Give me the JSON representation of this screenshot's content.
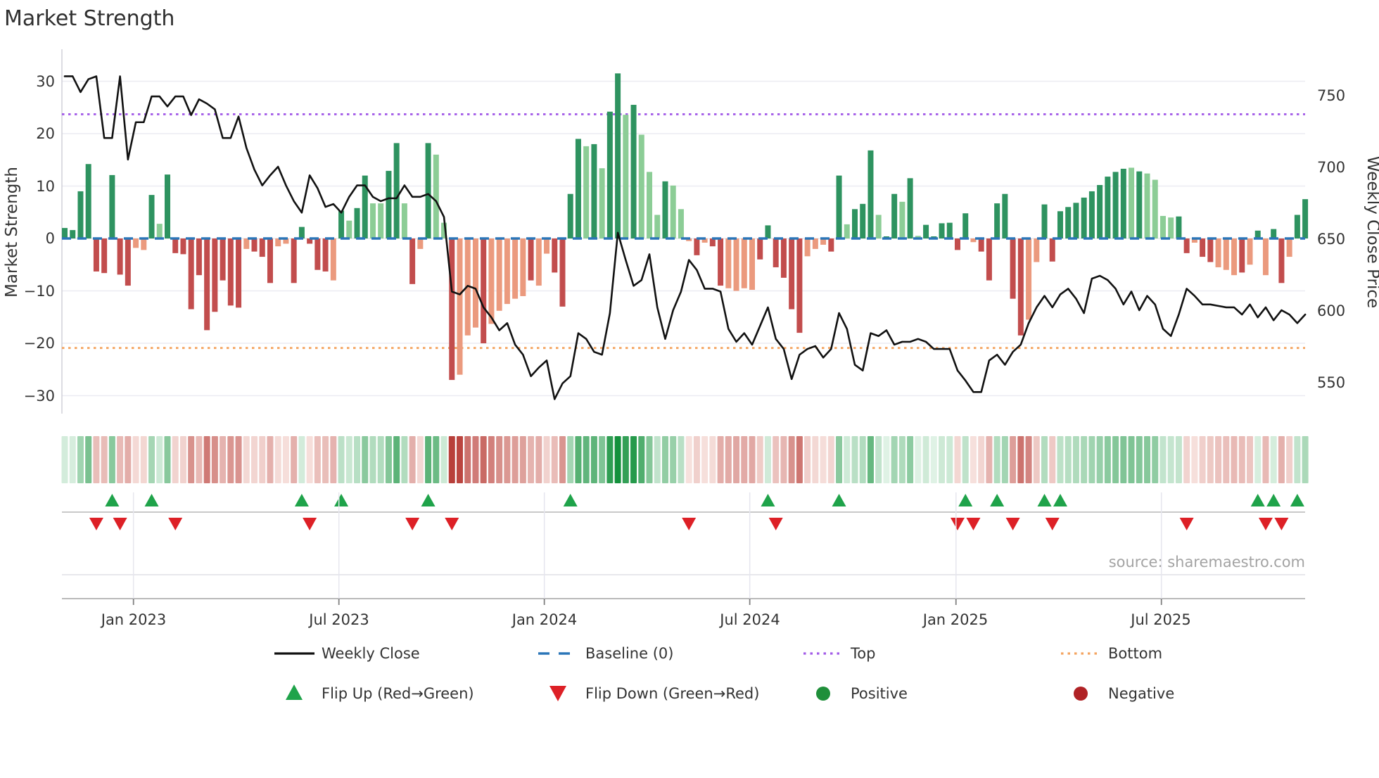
{
  "title": "Market Strength",
  "source_note": "source: sharemaestro.com",
  "axes": {
    "left": {
      "title": "Market Strength",
      "tick_labels": [
        "30",
        "20",
        "10",
        "0",
        "−10",
        "−20",
        "−30"
      ]
    },
    "right": {
      "title": "Weekly Close Price",
      "tick_labels": [
        "750",
        "700",
        "650",
        "600",
        "550"
      ]
    },
    "x": {
      "tick_labels": [
        "Jan 2023",
        "Jul 2023",
        "Jan 2024",
        "Jul 2024",
        "Jan 2025",
        "Jul 2025"
      ]
    }
  },
  "legend": {
    "weekly_close": "Weekly Close",
    "baseline": "Baseline (0)",
    "top": "Top",
    "bottom": "Bottom",
    "flip_up": "Flip Up (Red→Green)",
    "flip_down": "Flip Down (Green→Red)",
    "positive": "Positive",
    "negative": "Negative"
  },
  "colors": {
    "bar_green_dark": "#2e9360",
    "bar_green_light": "#8ccd96",
    "bar_red_dark": "#c24d4d",
    "bar_red_light": "#eb9a7e",
    "price_line": "#111111",
    "baseline": "#2b76b8",
    "top_line": "#a35ce8",
    "bottom_line": "#f4a460",
    "flip_up": "#1fa34a",
    "flip_down": "#dd2026",
    "positive_dot": "#1f8f3a",
    "negative_dot": "#b02225",
    "grid": "#ebebf2",
    "axis_text": "#333333",
    "source_text": "#a3a3a3",
    "heat_green_max": "#14913c",
    "heat_red_max": "#b63934"
  },
  "chart_data": {
    "type": "combo: weekly strength bars + weekly close line + heatmap strip + flip markers",
    "title": "Market Strength",
    "x_tick_labels": [
      "Jan 2023",
      "Jul 2023",
      "Jan 2024",
      "Jul 2024",
      "Jan 2025",
      "Jul 2025"
    ],
    "x_tick_weeks": [
      8.7,
      34.7,
      60.7,
      86.7,
      112.8,
      138.8
    ],
    "weeks_total": 158,
    "left_axis": {
      "label": "Market Strength",
      "ticks": [
        30,
        20,
        10,
        0,
        -10,
        -20,
        -30
      ],
      "range": [
        -33,
        33
      ]
    },
    "right_axis": {
      "label": "Weekly Close Price",
      "ticks": [
        750,
        700,
        650,
        600,
        550
      ],
      "range": [
        528,
        772
      ]
    },
    "baseline_level": 0,
    "top_level": 23.7,
    "bottom_level": -20.9,
    "bar_shades": {
      "d": "dark = momentum strengthening",
      "l": "light = momentum fading"
    },
    "strength": [
      [
        2,
        "d"
      ],
      [
        1.6,
        "d"
      ],
      [
        9,
        "d"
      ],
      [
        14.2,
        "d"
      ],
      [
        -6.3,
        "d"
      ],
      [
        -6.6,
        "d"
      ],
      [
        12.1,
        "d"
      ],
      [
        -6.9,
        "d"
      ],
      [
        -9,
        "d"
      ],
      [
        -1.8,
        "l"
      ],
      [
        -2.2,
        "l"
      ],
      [
        8.3,
        "d"
      ],
      [
        2.8,
        "l"
      ],
      [
        12.2,
        "d"
      ],
      [
        -2.8,
        "d"
      ],
      [
        -3,
        "d"
      ],
      [
        -13.5,
        "d"
      ],
      [
        -7,
        "d"
      ],
      [
        -17.5,
        "d"
      ],
      [
        -14,
        "d"
      ],
      [
        -8,
        "d"
      ],
      [
        -12.8,
        "d"
      ],
      [
        -13.2,
        "d"
      ],
      [
        -2,
        "l"
      ],
      [
        -2.5,
        "d"
      ],
      [
        -3.5,
        "d"
      ],
      [
        -8.5,
        "d"
      ],
      [
        -1.5,
        "l"
      ],
      [
        -1,
        "l"
      ],
      [
        -8.5,
        "d"
      ],
      [
        2.2,
        "d"
      ],
      [
        -1,
        "d"
      ],
      [
        -6,
        "d"
      ],
      [
        -6.3,
        "d"
      ],
      [
        -8,
        "l"
      ],
      [
        5.3,
        "d"
      ],
      [
        3.4,
        "l"
      ],
      [
        5.8,
        "d"
      ],
      [
        12,
        "d"
      ],
      [
        6.7,
        "l"
      ],
      [
        6.7,
        "l"
      ],
      [
        12.9,
        "d"
      ],
      [
        18.2,
        "d"
      ],
      [
        6.7,
        "l"
      ],
      [
        -8.7,
        "d"
      ],
      [
        -2,
        "l"
      ],
      [
        18.2,
        "d"
      ],
      [
        16,
        "l"
      ],
      [
        3,
        "l"
      ],
      [
        -27,
        "d"
      ],
      [
        -26,
        "l"
      ],
      [
        -18.5,
        "l"
      ],
      [
        -17,
        "l"
      ],
      [
        -20,
        "d"
      ],
      [
        -16.3,
        "l"
      ],
      [
        -13.8,
        "l"
      ],
      [
        -12.5,
        "l"
      ],
      [
        -11.5,
        "l"
      ],
      [
        -11,
        "l"
      ],
      [
        -8,
        "d"
      ],
      [
        -9,
        "l"
      ],
      [
        -2.9,
        "l"
      ],
      [
        -6.5,
        "d"
      ],
      [
        -13,
        "d"
      ],
      [
        8.5,
        "d"
      ],
      [
        19,
        "d"
      ],
      [
        17.6,
        "l"
      ],
      [
        18,
        "d"
      ],
      [
        13.4,
        "l"
      ],
      [
        24.2,
        "d"
      ],
      [
        31.5,
        "d"
      ],
      [
        23.6,
        "l"
      ],
      [
        25.5,
        "d"
      ],
      [
        19.8,
        "l"
      ],
      [
        12.7,
        "l"
      ],
      [
        4.5,
        "l"
      ],
      [
        10.9,
        "d"
      ],
      [
        10.1,
        "l"
      ],
      [
        5.6,
        "l"
      ],
      [
        -0.5,
        "l"
      ],
      [
        -3.2,
        "d"
      ],
      [
        -0.8,
        "l"
      ],
      [
        -1.5,
        "d"
      ],
      [
        -9,
        "d"
      ],
      [
        -9.5,
        "l"
      ],
      [
        -10,
        "l"
      ],
      [
        -9.5,
        "l"
      ],
      [
        -9.8,
        "l"
      ],
      [
        -4,
        "d"
      ],
      [
        2.5,
        "d"
      ],
      [
        -5.5,
        "d"
      ],
      [
        -7.5,
        "d"
      ],
      [
        -13.5,
        "d"
      ],
      [
        -18,
        "d"
      ],
      [
        -3.4,
        "l"
      ],
      [
        -2,
        "l"
      ],
      [
        -1.2,
        "l"
      ],
      [
        -2.5,
        "d"
      ],
      [
        12,
        "d"
      ],
      [
        2.7,
        "l"
      ],
      [
        5.6,
        "d"
      ],
      [
        6.6,
        "d"
      ],
      [
        16.8,
        "d"
      ],
      [
        4.5,
        "l"
      ],
      [
        0.4,
        "d"
      ],
      [
        8.5,
        "d"
      ],
      [
        7,
        "l"
      ],
      [
        11.5,
        "d"
      ],
      [
        0.5,
        "l"
      ],
      [
        2.6,
        "d"
      ],
      [
        0.4,
        "d"
      ],
      [
        2.9,
        "d"
      ],
      [
        3,
        "d"
      ],
      [
        -2.2,
        "d"
      ],
      [
        4.8,
        "d"
      ],
      [
        -0.7,
        "l"
      ],
      [
        -2.5,
        "d"
      ],
      [
        -8,
        "d"
      ],
      [
        6.7,
        "d"
      ],
      [
        8.5,
        "d"
      ],
      [
        -11.5,
        "d"
      ],
      [
        -18.5,
        "d"
      ],
      [
        -15.5,
        "l"
      ],
      [
        -4.5,
        "l"
      ],
      [
        6.5,
        "d"
      ],
      [
        -4.4,
        "d"
      ],
      [
        5.2,
        "d"
      ],
      [
        6,
        "d"
      ],
      [
        6.8,
        "d"
      ],
      [
        7.8,
        "d"
      ],
      [
        9,
        "d"
      ],
      [
        10.2,
        "d"
      ],
      [
        11.8,
        "d"
      ],
      [
        12.7,
        "d"
      ],
      [
        13.3,
        "d"
      ],
      [
        13.5,
        "l"
      ],
      [
        12.8,
        "d"
      ],
      [
        12.4,
        "l"
      ],
      [
        11.2,
        "l"
      ],
      [
        4.3,
        "l"
      ],
      [
        4,
        "l"
      ],
      [
        4.2,
        "d"
      ],
      [
        -2.8,
        "d"
      ],
      [
        -0.8,
        "l"
      ],
      [
        -3.5,
        "d"
      ],
      [
        -4.5,
        "d"
      ],
      [
        -5.5,
        "l"
      ],
      [
        -6,
        "l"
      ],
      [
        -7,
        "l"
      ],
      [
        -6.5,
        "d"
      ],
      [
        -5,
        "l"
      ],
      [
        1.5,
        "d"
      ],
      [
        -7,
        "l"
      ],
      [
        1.8,
        "d"
      ],
      [
        -8.5,
        "d"
      ],
      [
        -3.5,
        "l"
      ],
      [
        4.5,
        "d"
      ],
      [
        7.5,
        "d"
      ]
    ],
    "price": [
      763,
      763,
      752,
      761,
      763,
      720,
      720,
      763,
      705,
      731,
      731,
      749,
      749,
      742,
      749,
      749,
      736,
      747,
      744,
      740,
      720,
      720,
      735,
      713,
      698,
      687,
      694,
      700,
      687,
      676,
      668,
      694,
      685,
      672,
      674,
      668,
      679,
      687,
      687,
      679,
      676,
      678,
      678,
      687,
      679,
      679,
      681,
      676,
      665,
      613,
      611,
      617,
      615,
      602,
      595,
      586,
      591,
      576,
      569,
      554,
      560,
      565,
      538,
      549,
      554,
      584,
      580,
      571,
      569,
      598,
      654,
      635,
      617,
      621,
      639,
      602,
      580,
      600,
      613,
      635,
      628,
      615,
      615,
      613,
      587,
      578,
      584,
      576,
      589,
      602,
      580,
      573,
      552,
      569,
      573,
      575,
      567,
      573,
      598,
      587,
      562,
      558,
      584,
      582,
      586,
      576,
      578,
      578,
      580,
      578,
      573,
      573,
      573,
      558,
      551,
      543,
      543,
      565,
      569,
      562,
      571,
      576,
      591,
      602,
      610,
      602,
      611,
      615,
      608,
      598,
      622,
      624,
      621,
      615,
      604,
      613,
      600,
      610,
      604,
      587,
      582,
      597,
      615,
      610,
      604,
      604,
      603,
      602,
      602,
      597,
      604,
      595,
      602,
      593,
      600,
      597,
      591,
      597
    ],
    "flip_marker_rule": "up triangle where bar flips negative→positive; down triangle where bar flips positive→negative",
    "heatmap_rule": "one cell per week; green intensity for positive strength, red intensity for negative strength"
  }
}
